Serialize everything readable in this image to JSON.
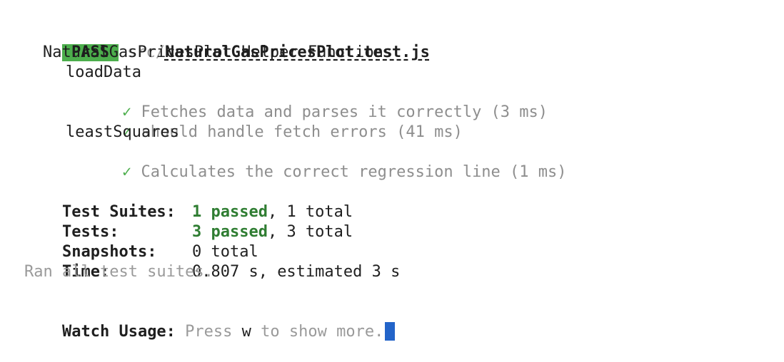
{
  "summary_line": {
    "status": "PASS",
    "file_dir": "src/",
    "file_name": "NaturalGasPricesPlot.test.js"
  },
  "describe": "NaturalGasPricesPlot Helper Functions",
  "groups": [
    {
      "name": "loadData",
      "tests": [
        {
          "check": "✓",
          "name": "Fetches data and parses it correctly (3 ms)"
        },
        {
          "check": "✓",
          "name": "should handle fetch errors (41 ms)"
        }
      ]
    },
    {
      "name": "leastSquares",
      "tests": [
        {
          "check": "✓",
          "name": "Calculates the correct regression line (1 ms)"
        }
      ]
    }
  ],
  "stats": {
    "suites": {
      "label": "Test Suites:",
      "passed": "1 passed",
      "rest": ", 1 total"
    },
    "tests": {
      "label": "Tests:",
      "passed": "3 passed",
      "rest": ", 3 total"
    },
    "snapshots": {
      "label": "Snapshots:",
      "value": "0 total"
    },
    "time": {
      "label": "Time:",
      "value": "0.807 s, estimated 3 s"
    }
  },
  "ran_all": "Ran all test suites.",
  "watch": {
    "label": "Watch Usage:",
    "press": " Press ",
    "key": "w",
    "rest": " to show more."
  },
  "colors": {
    "pass_badge": "#4cae4c",
    "passed_text": "#2f7d32",
    "cursor": "#2364c9"
  }
}
